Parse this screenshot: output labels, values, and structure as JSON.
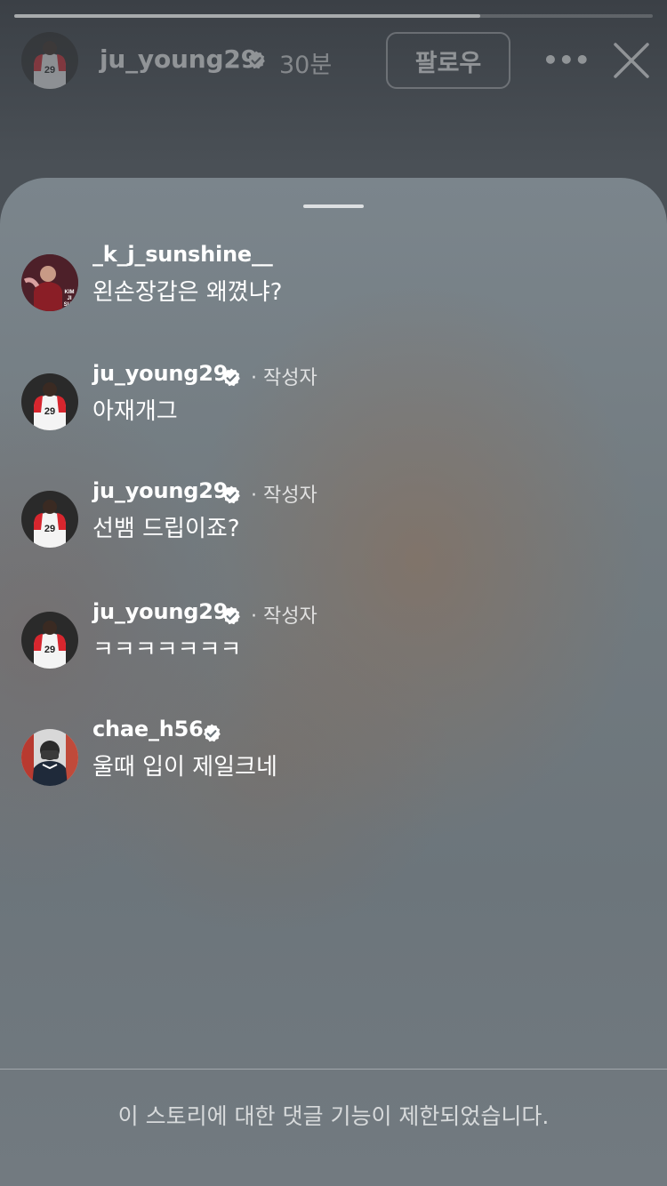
{
  "story": {
    "progress": 0.73,
    "username": "ju_young29",
    "time": "30분",
    "follow_label": "팔로우",
    "more_label": "•••"
  },
  "comments": [
    {
      "username": "_k_j_sunshine__",
      "verified": false,
      "author_tag": "",
      "text": "왼손장갑은 왜꼈냐?",
      "avatar_label": "KIM JI SUN"
    },
    {
      "username": "ju_young29",
      "verified": true,
      "author_tag": "· 작성자",
      "text": "아재개그",
      "avatar_label": "29"
    },
    {
      "username": "ju_young29",
      "verified": true,
      "author_tag": "· 작성자",
      "text": "선뱀 드립이죠?",
      "avatar_label": "29"
    },
    {
      "username": "ju_young29",
      "verified": true,
      "author_tag": "· 작성자",
      "text": "ㅋㅋㅋㅋㅋㅋㅋ",
      "avatar_label": "29"
    },
    {
      "username": "chae_h56",
      "verified": true,
      "author_tag": "",
      "text": "울때 입이 제일크네",
      "avatar_label": ""
    }
  ],
  "footer": {
    "notice": "이 스토리에 대한 댓글 기능이 제한되었습니다."
  },
  "colors": {
    "verified": "#ffffff",
    "jersey_red": "#d7262e",
    "jersey_white": "#f4f4f4"
  },
  "icons": [
    "verified-badge-icon",
    "more-options-icon",
    "close-icon"
  ]
}
